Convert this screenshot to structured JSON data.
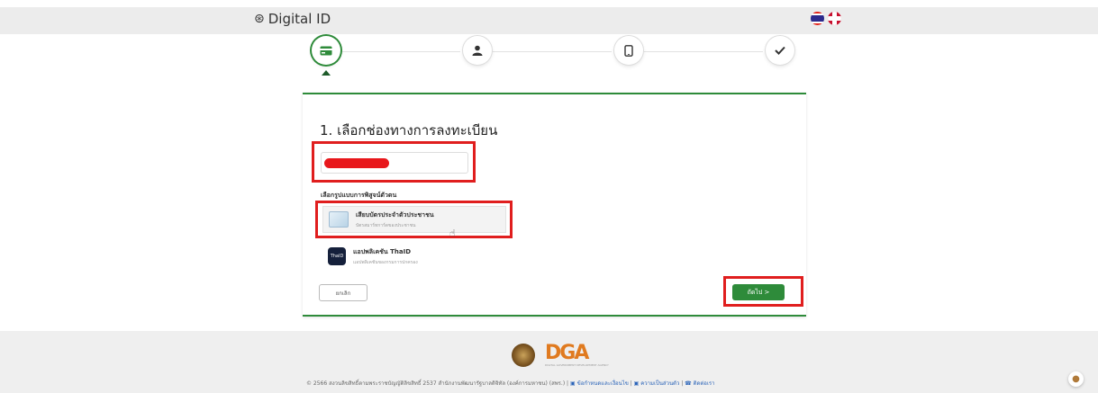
{
  "header": {
    "brand_icon": "fingerprint-icon",
    "brand_title": "Digital ID",
    "languages": [
      "th-flag-icon",
      "uk-flag-icon"
    ]
  },
  "stepper": {
    "steps": [
      {
        "icon": "id-card-icon",
        "active": true
      },
      {
        "icon": "user-icon",
        "active": false
      },
      {
        "icon": "mobile-icon",
        "active": false
      },
      {
        "icon": "check-icon",
        "active": false
      }
    ]
  },
  "card": {
    "title": "1. เลือกช่องทางการลงทะเบียน",
    "options_label": "เลือกรูปแบบการพิสูจน์ตัวตน",
    "options": [
      {
        "title": "เสียบบัตรประจำตัวประชาชน",
        "subtitle": "บัตรสมาร์ทการ์ดของประชาชน",
        "icon": "id-card-icon"
      },
      {
        "title": "แอปพลิเคชัน ThaID",
        "subtitle": "แอปพลิเคชันของกรมการปกครอง",
        "icon": "thaid-app-icon"
      }
    ],
    "cancel_label": "ยกเลิก",
    "next_label": "ถัดไป >",
    "app_icon_text": "ThaID"
  },
  "footer": {
    "copyright": "© 2566 สงวนลิขสิทธิ์ตามพระราชบัญญัติลิขสิทธิ์ 2537 สำนักงานพัฒนารัฐบาลดิจิทัล (องค์การมหาชน) (สพร.) |",
    "links": [
      "ข้อกำหนดและเงื่อนไข",
      "ความเป็นส่วนตัว",
      "ติดต่อเรา"
    ],
    "dga_text": "DGA",
    "dga_sub": "DIGITAL GOVERNMENT DEVELOPMENT AGENCY"
  },
  "colors": {
    "accent": "#2e8b3a",
    "highlight": "#e01e1e",
    "link": "#2a63b8"
  }
}
